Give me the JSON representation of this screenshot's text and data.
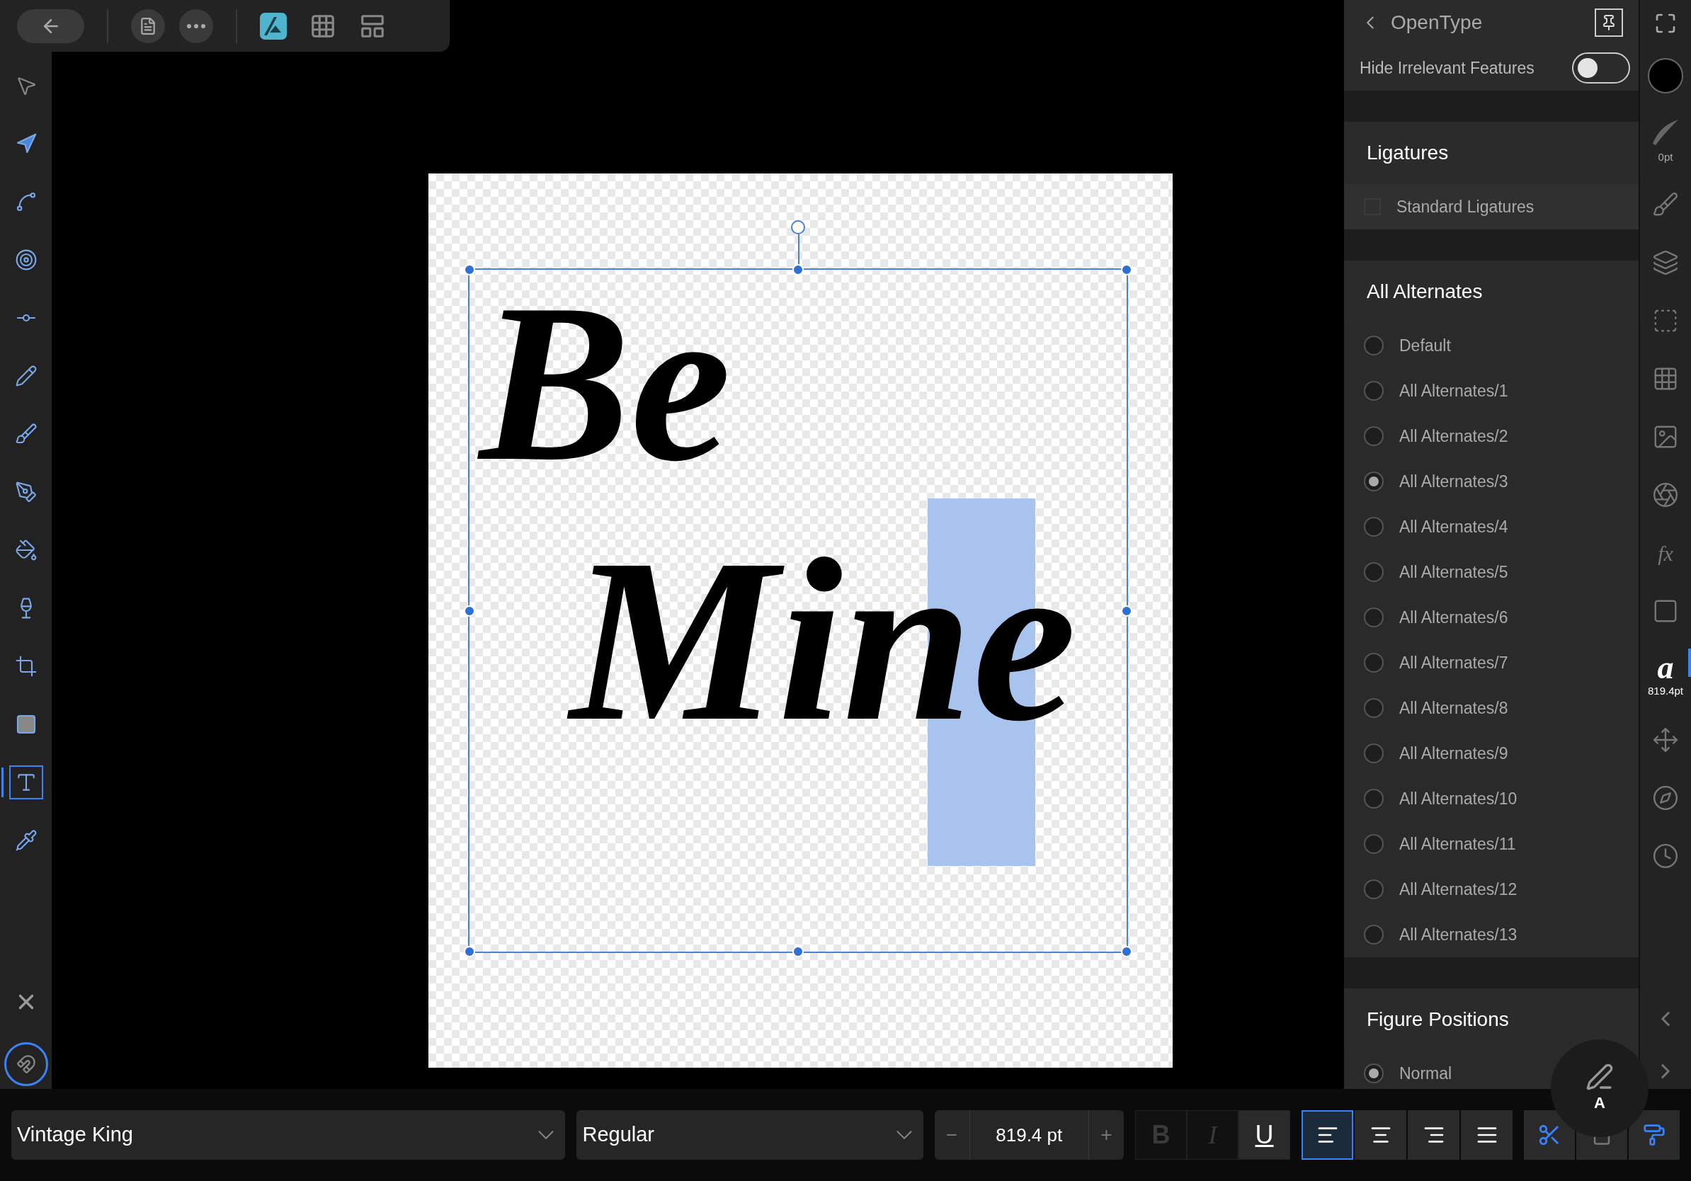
{
  "tools": [
    {
      "selected": false
    },
    {
      "selected": false
    },
    {
      "selected": false
    },
    {
      "selected": false
    },
    {
      "selected": false
    },
    {
      "selected": false
    },
    {
      "selected": false
    },
    {
      "selected": false
    },
    {
      "selected": false
    },
    {
      "selected": false
    },
    {
      "selected": false
    },
    {
      "selected": false
    },
    {
      "selected": true
    },
    {
      "selected": false
    }
  ],
  "document": {
    "lines": [
      "Be",
      "Mine"
    ]
  },
  "panel": {
    "title": "OpenType",
    "hide_irrelevant": {
      "label": "Hide Irrelevant Features",
      "on": false
    },
    "sections": [
      {
        "title": "Ligatures",
        "options": [
          {
            "kind": "checkbox",
            "label": "Standard Ligatures",
            "checked": false
          }
        ]
      },
      {
        "title": "All Alternates",
        "options": [
          {
            "kind": "radio",
            "label": "Default",
            "selected": false
          },
          {
            "kind": "radio",
            "label": "All Alternates/1",
            "selected": false
          },
          {
            "kind": "radio",
            "label": "All Alternates/2",
            "selected": false
          },
          {
            "kind": "radio",
            "label": "All Alternates/3",
            "selected": true
          },
          {
            "kind": "radio",
            "label": "All Alternates/4",
            "selected": false
          },
          {
            "kind": "radio",
            "label": "All Alternates/5",
            "selected": false
          },
          {
            "kind": "radio",
            "label": "All Alternates/6",
            "selected": false
          },
          {
            "kind": "radio",
            "label": "All Alternates/7",
            "selected": false
          },
          {
            "kind": "radio",
            "label": "All Alternates/8",
            "selected": false
          },
          {
            "kind": "radio",
            "label": "All Alternates/9",
            "selected": false
          },
          {
            "kind": "radio",
            "label": "All Alternates/10",
            "selected": false
          },
          {
            "kind": "radio",
            "label": "All Alternates/11",
            "selected": false
          },
          {
            "kind": "radio",
            "label": "All Alternates/12",
            "selected": false
          },
          {
            "kind": "radio",
            "label": "All Alternates/13",
            "selected": false
          }
        ]
      },
      {
        "title": "Figure Positions",
        "options": [
          {
            "kind": "radio",
            "label": "Normal",
            "selected": true
          }
        ]
      }
    ]
  },
  "studio": [
    {
      "kind": "color",
      "selected": false
    },
    {
      "kind": "stroke",
      "label": "0pt",
      "selected": false
    },
    {
      "kind": "brush",
      "selected": false
    },
    {
      "kind": "layers",
      "selected": false
    },
    {
      "kind": "selection",
      "selected": false
    },
    {
      "kind": "swatches",
      "selected": false
    },
    {
      "kind": "image",
      "selected": false
    },
    {
      "kind": "aperture",
      "selected": false
    },
    {
      "kind": "fx",
      "glyph": "fx",
      "selected": false
    },
    {
      "kind": "styles",
      "selected": false
    },
    {
      "kind": "text",
      "glyph": "a",
      "label": "819.4pt",
      "selected": true
    },
    {
      "kind": "transform",
      "selected": false
    },
    {
      "kind": "navigator",
      "selected": false
    },
    {
      "kind": "history",
      "selected": false
    }
  ],
  "pencil_hover": {
    "label": "A"
  },
  "bottom": {
    "font": "Vintage King",
    "style": "Regular",
    "size": "819.4 pt",
    "minus": "−",
    "plus": "+",
    "styles": [
      {
        "label": "B",
        "kind": "bold",
        "disabled": true
      },
      {
        "label": "I",
        "kind": "italic",
        "disabled": true
      },
      {
        "label": "U",
        "kind": "underline",
        "disabled": false
      }
    ],
    "alignment": [
      {
        "selected": true
      },
      {
        "selected": false
      },
      {
        "selected": false
      },
      {
        "selected": false
      }
    ]
  }
}
